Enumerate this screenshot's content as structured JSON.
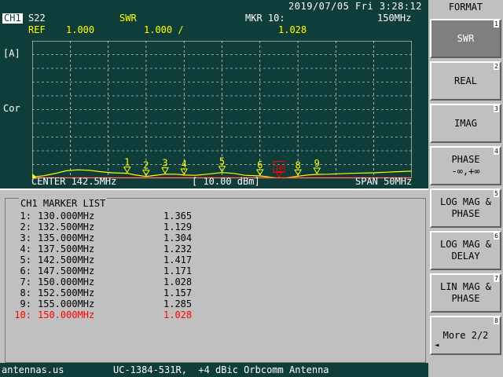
{
  "status": {
    "datetime": "2019/07/05 Fri   3:28:12"
  },
  "trace": {
    "channel": "CH1",
    "parameter": "S22",
    "format": "SWR",
    "marker_label": "MKR 10:",
    "marker_freq": "150MHz",
    "ref_label": "REF",
    "ref_value": "1.000",
    "scale": "1.000 /",
    "marker_value": "1.028",
    "unit": "[A]",
    "cor": "Cor",
    "center": "CENTER 142.5MHz",
    "power": "[ 10.00 dBm]",
    "span": "SPAN 50MHz"
  },
  "chart_data": {
    "type": "line",
    "xlim": [
      117.5,
      167.5
    ],
    "ylim": [
      1.0,
      11.0
    ],
    "grid": true,
    "x": [
      117.5,
      119.0,
      120.5,
      122.0,
      123.5,
      125.0,
      126.5,
      128.0,
      129.5,
      130.0,
      131.0,
      132.5,
      133.5,
      135.0,
      136.5,
      137.5,
      139.0,
      140.5,
      142.5,
      144.0,
      145.5,
      147.5,
      149.0,
      150.0,
      151.0,
      152.5,
      154.0,
      155.0,
      156.5,
      158.0,
      159.5,
      161.0,
      162.5,
      164.0,
      165.5,
      167.5
    ],
    "values": [
      1.1,
      1.18,
      1.35,
      1.55,
      1.62,
      1.58,
      1.48,
      1.4,
      1.37,
      1.365,
      1.25,
      1.129,
      1.2,
      1.304,
      1.3,
      1.232,
      1.22,
      1.3,
      1.417,
      1.36,
      1.22,
      1.171,
      1.08,
      1.028,
      1.05,
      1.157,
      1.25,
      1.285,
      1.3,
      1.33,
      1.36,
      1.38,
      1.4,
      1.44,
      1.48,
      1.52
    ],
    "markers": [
      {
        "label": "1",
        "x": 130.0,
        "y": 1.365
      },
      {
        "label": "2",
        "x": 132.5,
        "y": 1.129
      },
      {
        "label": "3",
        "x": 135.0,
        "y": 1.304
      },
      {
        "label": "4",
        "x": 137.5,
        "y": 1.232
      },
      {
        "label": "5",
        "x": 142.5,
        "y": 1.417
      },
      {
        "label": "6",
        "x": 147.5,
        "y": 1.171
      },
      {
        "label": "10",
        "x": 150.0,
        "y": 1.028
      },
      {
        "label": "8",
        "x": 152.5,
        "y": 1.157
      },
      {
        "label": "9",
        "x": 155.0,
        "y": 1.285
      }
    ],
    "colors": {
      "trace": "#ffff00",
      "grid": "#ffffff",
      "background": "#0f3d3a",
      "active_marker": "#ff0000"
    }
  },
  "marker_list": {
    "title": "CH1 MARKER LIST",
    "rows": [
      {
        "num": "1:",
        "freq": "130.000MHz",
        "value": "1.365"
      },
      {
        "num": "2:",
        "freq": "132.500MHz",
        "value": "1.129"
      },
      {
        "num": "3:",
        "freq": "135.000MHz",
        "value": "1.304"
      },
      {
        "num": "4:",
        "freq": "137.500MHz",
        "value": "1.232"
      },
      {
        "num": "5:",
        "freq": "142.500MHz",
        "value": "1.417"
      },
      {
        "num": "6:",
        "freq": "147.500MHz",
        "value": "1.171"
      },
      {
        "num": "7:",
        "freq": "150.000MHz",
        "value": "1.028"
      },
      {
        "num": "8:",
        "freq": "152.500MHz",
        "value": "1.157"
      },
      {
        "num": "9:",
        "freq": "155.000MHz",
        "value": "1.285"
      },
      {
        "num": "10:",
        "freq": "150.000MHz",
        "value": "1.028",
        "active": true
      }
    ]
  },
  "footer": {
    "left": "antennas.us",
    "right": "UC-1384-531R,  +4 dBic Orbcomm Antenna"
  },
  "softkeys": {
    "title": "FORMAT",
    "keys": [
      {
        "line1": "SWR",
        "line2": "",
        "num": "1",
        "selected": true
      },
      {
        "line1": "REAL",
        "line2": "",
        "num": "2"
      },
      {
        "line1": "IMAG",
        "line2": "",
        "num": "3"
      },
      {
        "line1": "PHASE",
        "line2": "-∞,+∞",
        "num": "4"
      },
      {
        "line1": "LOG MAG &",
        "line2": "PHASE",
        "num": "5"
      },
      {
        "line1": "LOG MAG &",
        "line2": "DELAY",
        "num": "6"
      },
      {
        "line1": "LIN MAG &",
        "line2": "PHASE",
        "num": "7"
      },
      {
        "line1": "More 2/2",
        "line2": "",
        "num": "8",
        "arrow": "◄"
      }
    ]
  }
}
